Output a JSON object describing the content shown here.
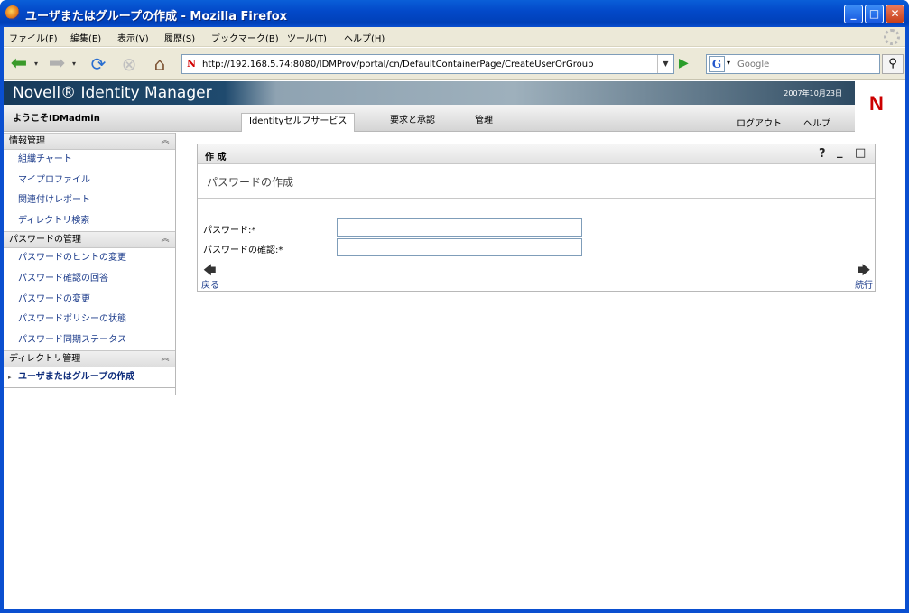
{
  "window": {
    "title": "ユーザまたはグループの作成 - Mozilla Firefox",
    "buttons": {
      "minimize": "_",
      "maximize": "□",
      "close": "✕"
    }
  },
  "menubar": {
    "items": [
      "ファイル(F)",
      "編集(E)",
      "表示(V)",
      "履歴(S)",
      "ブックマーク(B)",
      "ツール(T)",
      "ヘルプ(H)"
    ]
  },
  "navbar": {
    "url": "http://192.168.5.74:8080/IDMProv/portal/cn/DefaultContainerPage/CreateUserOrGroup",
    "search_placeholder": "Google",
    "icons": [
      "back-icon",
      "forward-icon",
      "reload-icon",
      "stop-icon",
      "home-icon",
      "go-icon",
      "search-icon"
    ]
  },
  "header": {
    "brand": "Novell® Identity Manager",
    "date": "2007年10月23日",
    "logo": "N"
  },
  "subbar": {
    "welcome": "ようこそIDMadmin",
    "tabs": [
      "Identityセルフサービス",
      "要求と承認",
      "管理"
    ],
    "active_tab": "Identityセルフサービス",
    "links": [
      "ログアウト",
      "ヘルプ"
    ]
  },
  "sidebar": {
    "sections": [
      {
        "title": "情報管理",
        "items": [
          "組織チャート",
          "マイプロファイル",
          "関連付けレポート",
          "ディレクトリ検索"
        ]
      },
      {
        "title": "パスワードの管理",
        "items": [
          "パスワードのヒントの変更",
          "パスワード確認の回答",
          "パスワードの変更",
          "パスワードポリシーの状態",
          "パスワード同期ステータス"
        ]
      },
      {
        "title": "ディレクトリ管理",
        "items": [
          "ユーザまたはグループの作成"
        ]
      }
    ],
    "current_item": "ユーザまたはグループの作成"
  },
  "portlet": {
    "title": "作 成",
    "subtitle": "パスワードの作成",
    "controls": {
      "help": "?",
      "minimize": "_",
      "maximize": "□"
    },
    "fields": [
      {
        "label": "パスワード:*",
        "value": ""
      },
      {
        "label": "パスワードの確認:*",
        "value": ""
      }
    ],
    "back_label": "戻る",
    "continue_label": "続行"
  }
}
